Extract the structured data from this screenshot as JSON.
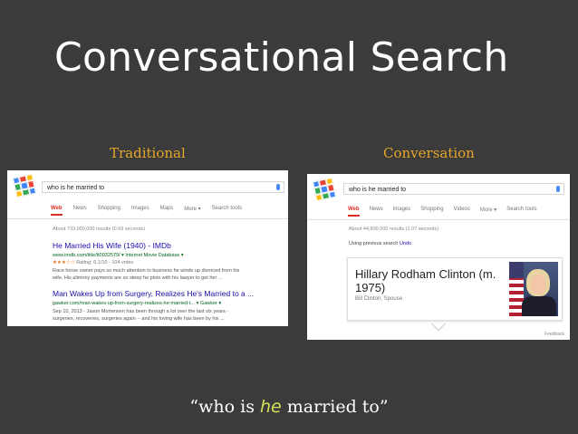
{
  "slide": {
    "title": "Conversational Search",
    "caption": {
      "open": "“who is ",
      "emphasis": "he",
      "close": " married to”"
    },
    "colors": {
      "background": "#3b3b3b",
      "label": "#e7a62a",
      "emphasis": "#d7e05a"
    }
  },
  "traditional": {
    "label": "Traditional",
    "query": "who is he married to",
    "tabs": [
      "Web",
      "News",
      "Shopping",
      "Images",
      "Maps",
      "More ▾",
      "Search tools"
    ],
    "result_stats": "About 733,000,000 results (0.69 seconds)",
    "results": [
      {
        "title": "He Married His Wife (1940) - IMDb",
        "url": "www.imdb.com/title/tt0032579/ ▾ Internet Movie Database ▾",
        "rating_stars": "★★★☆☆",
        "rating": "Rating: 6.1/10 - 104 votes",
        "snippet": [
          "Race horse owner pays so much attention to business he winds up divorced from his",
          "wife. His alimony payments are so steep he plots with his lawyer to get her ..."
        ]
      },
      {
        "title": "Man Wakes Up from Surgery, Realizes He's Married to a ...",
        "url": "gawker.com/man-wakes-up-from-surgery-realizes-he-married-t... ▾ Gawker ▾",
        "snippet": [
          "Sep 10, 2013 - Jason Mortensen has been through a lot over the last six years -",
          "surgeries, recoveries, surgeries again -- and his loving wife has been by his ..."
        ]
      }
    ]
  },
  "conversation": {
    "label": "Conversation",
    "query": "who is he married to",
    "tabs": [
      "Web",
      "News",
      "Images",
      "Shopping",
      "Videos",
      "More ▾",
      "Search tools"
    ],
    "result_stats": "About 44,800,000 results (1.07 seconds)",
    "previous_search_text": "Using previous search",
    "undo": "Undo",
    "card": {
      "title": "Hillary Rodham Clinton (m. 1975)",
      "subtitle": "Bill Clinton, Spouse"
    },
    "feedback": "Feedback"
  }
}
